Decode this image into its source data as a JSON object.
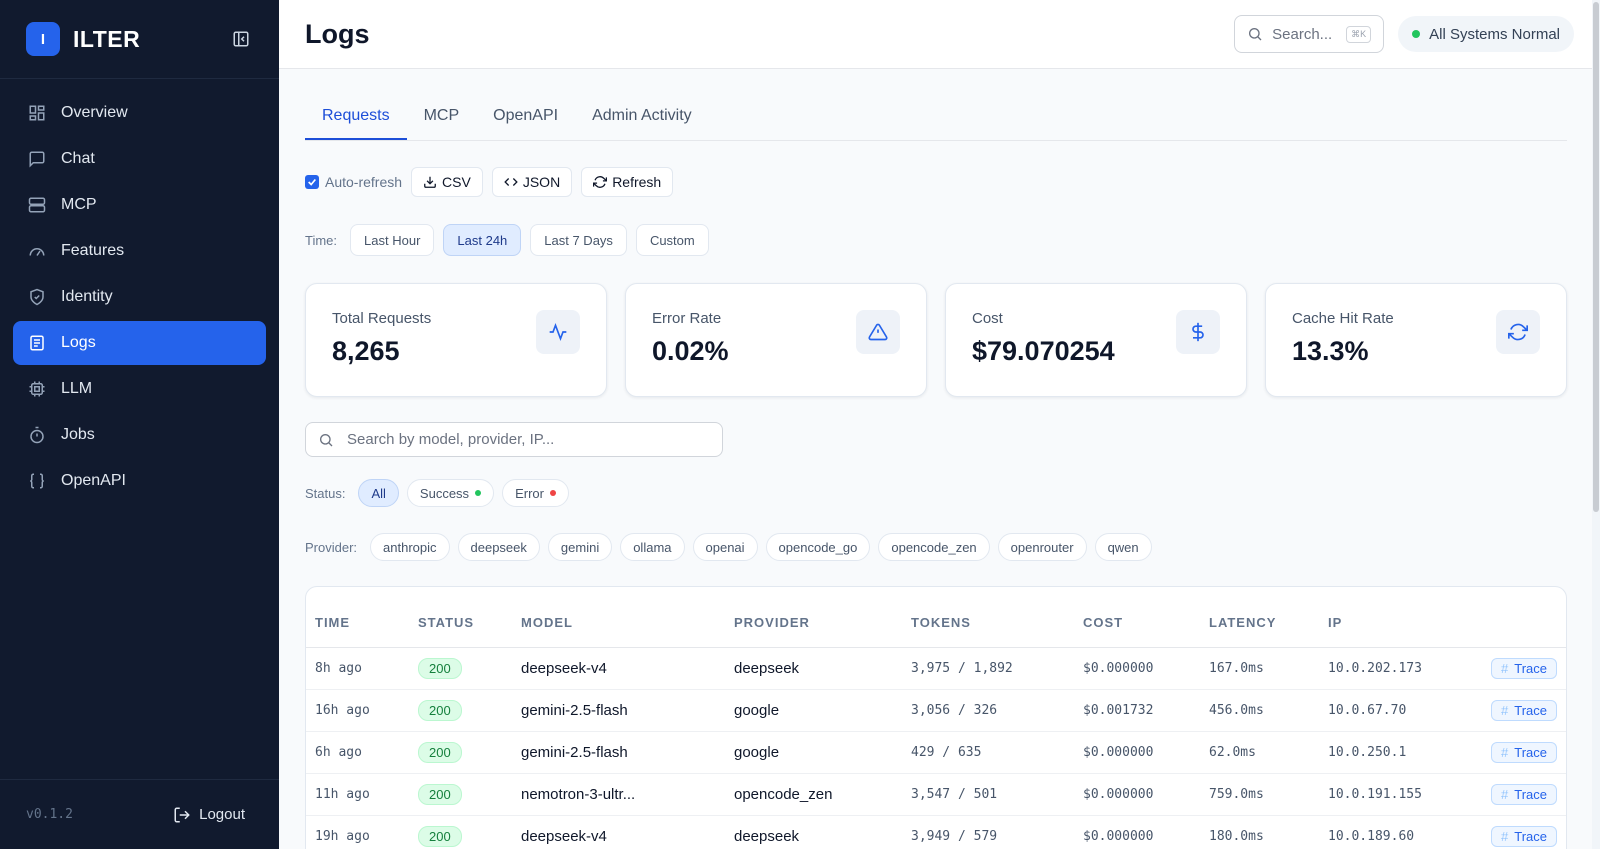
{
  "brand": {
    "logo_letter": "I",
    "name": "ILTER"
  },
  "sidebar": {
    "items": [
      {
        "label": "Overview",
        "icon": "grid-icon",
        "active": false
      },
      {
        "label": "Chat",
        "icon": "chat-icon",
        "active": false
      },
      {
        "label": "MCP",
        "icon": "server-icon",
        "active": false
      },
      {
        "label": "Features",
        "icon": "gauge-icon",
        "active": false
      },
      {
        "label": "Identity",
        "icon": "shield-icon",
        "active": false
      },
      {
        "label": "Logs",
        "icon": "document-icon",
        "active": true
      },
      {
        "label": "LLM",
        "icon": "cpu-icon",
        "active": false
      },
      {
        "label": "Jobs",
        "icon": "timer-icon",
        "active": false
      },
      {
        "label": "OpenAPI",
        "icon": "braces-icon",
        "active": false
      }
    ],
    "version": "v0.1.2",
    "logout_label": "Logout"
  },
  "header": {
    "title": "Logs",
    "search_placeholder": "Search...",
    "search_shortcut": "⌘K",
    "system_status": "All Systems Normal"
  },
  "tabs": [
    {
      "label": "Requests",
      "active": true
    },
    {
      "label": "MCP",
      "active": false
    },
    {
      "label": "OpenAPI",
      "active": false
    },
    {
      "label": "Admin Activity",
      "active": false
    }
  ],
  "actions": {
    "auto_refresh_label": "Auto-refresh",
    "auto_refresh_checked": true,
    "csv_label": "CSV",
    "json_label": "JSON",
    "refresh_label": "Refresh"
  },
  "time_filter": {
    "label": "Time:",
    "options": [
      {
        "label": "Last Hour",
        "active": false
      },
      {
        "label": "Last 24h",
        "active": true
      },
      {
        "label": "Last 7 Days",
        "active": false
      },
      {
        "label": "Custom",
        "active": false
      }
    ]
  },
  "stats": [
    {
      "label": "Total Requests",
      "value": "8,265",
      "icon": "activity-icon"
    },
    {
      "label": "Error Rate",
      "value": "0.02%",
      "icon": "warning-icon"
    },
    {
      "label": "Cost",
      "value": "$79.070254",
      "icon": "dollar-icon"
    },
    {
      "label": "Cache Hit Rate",
      "value": "13.3%",
      "icon": "refresh-icon"
    }
  ],
  "filter_search_placeholder": "Search by model, provider, IP...",
  "status_filter": {
    "label": "Status:",
    "options": [
      {
        "label": "All",
        "active": true
      },
      {
        "label": "Success",
        "dot": "#22c55e"
      },
      {
        "label": "Error",
        "dot": "#ef4444"
      }
    ]
  },
  "provider_filter": {
    "label": "Provider:",
    "options": [
      "anthropic",
      "deepseek",
      "gemini",
      "ollama",
      "openai",
      "opencode_go",
      "opencode_zen",
      "openrouter",
      "qwen"
    ]
  },
  "table": {
    "columns": [
      "TIME",
      "STATUS",
      "MODEL",
      "PROVIDER",
      "TOKENS",
      "COST",
      "LATENCY",
      "IP"
    ],
    "trace_label": "Trace",
    "rows": [
      {
        "time": "8h ago",
        "status": "200",
        "model": "deepseek-v4",
        "provider": "deepseek",
        "tokens": "3,975 / 1,892",
        "cost": "$0.000000",
        "latency": "167.0ms",
        "ip": "10.0.202.173"
      },
      {
        "time": "16h ago",
        "status": "200",
        "model": "gemini-2.5-flash",
        "provider": "google",
        "tokens": "3,056 / 326",
        "cost": "$0.001732",
        "latency": "456.0ms",
        "ip": "10.0.67.70"
      },
      {
        "time": "6h ago",
        "status": "200",
        "model": "gemini-2.5-flash",
        "provider": "google",
        "tokens": "429 / 635",
        "cost": "$0.000000",
        "latency": "62.0ms",
        "ip": "10.0.250.1"
      },
      {
        "time": "11h ago",
        "status": "200",
        "model": "nemotron-3-ultr...",
        "provider": "opencode_zen",
        "tokens": "3,547 / 501",
        "cost": "$0.000000",
        "latency": "759.0ms",
        "ip": "10.0.191.155"
      },
      {
        "time": "19h ago",
        "status": "200",
        "model": "deepseek-v4",
        "provider": "deepseek",
        "tokens": "3,949 / 579",
        "cost": "$0.000000",
        "latency": "180.0ms",
        "ip": "10.0.189.60"
      }
    ]
  },
  "colors": {
    "sidebar_bg": "#111a2e",
    "accent": "#2563eb",
    "success": "#22c55e",
    "error": "#ef4444"
  }
}
